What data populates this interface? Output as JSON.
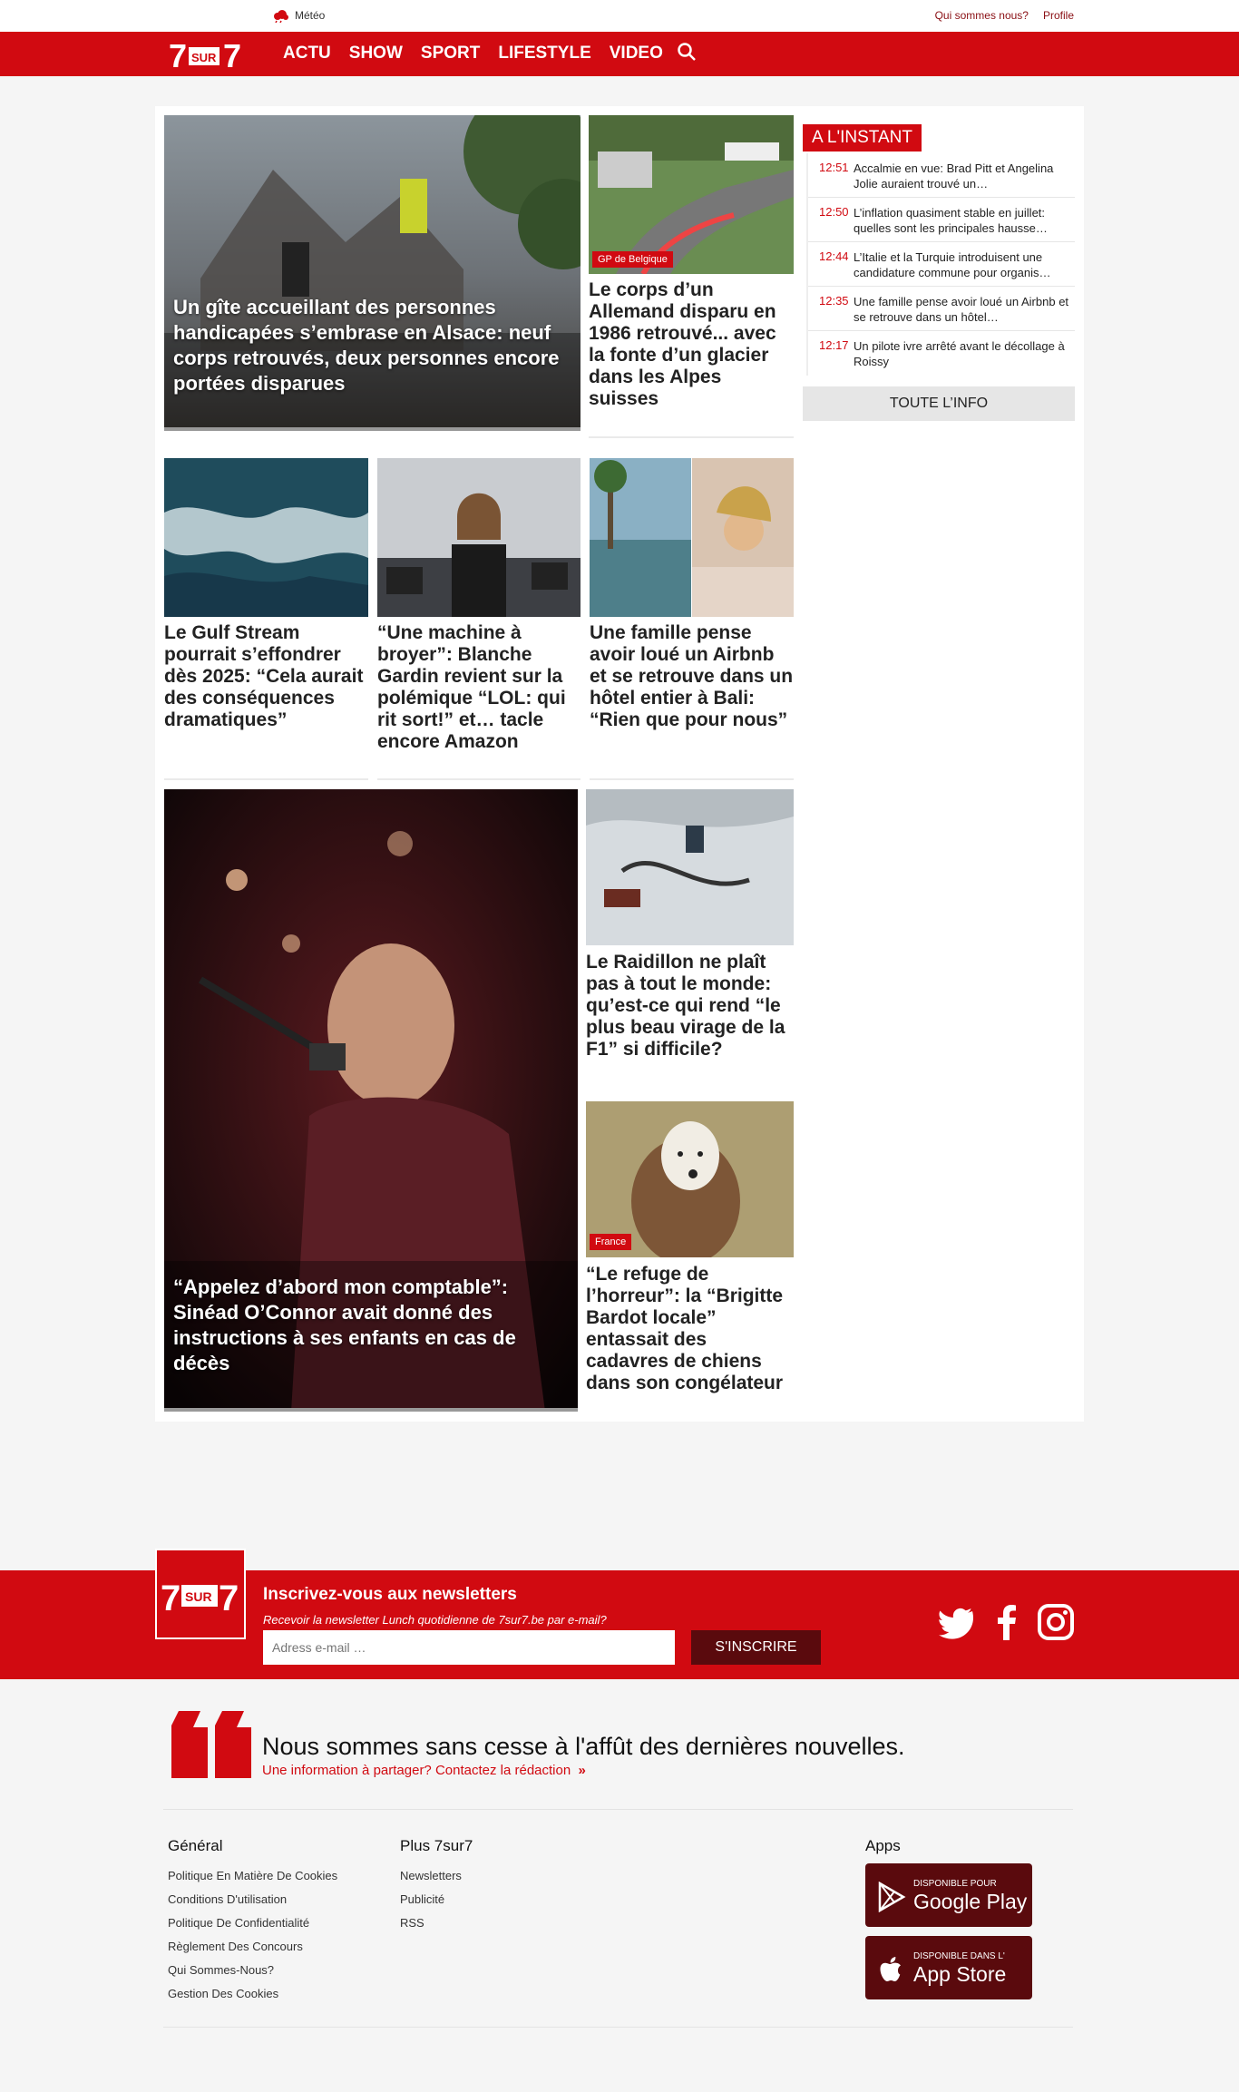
{
  "topbar": {
    "meteo": "Météo",
    "links": [
      "Qui sommes nous?",
      "Profile"
    ]
  },
  "nav": {
    "logo": "7SUR7",
    "items": [
      "ACTU",
      "SHOW",
      "SPORT",
      "LIFESTYLE",
      "VIDEO"
    ]
  },
  "articles": [
    {
      "title": "Un gîte accueillant des personnes handicapées s’embrase en Alsace: neuf corps retrouvés, deux personnes encore portées disparues"
    },
    {
      "tag": "GP de Belgique",
      "title": "Le corps d’un Allemand disparu en 1986 retrouvé... avec la fonte d’un glacier dans les Alpes suisses"
    },
    {
      "title": "Le Gulf Stream pourrait s’effondrer dès 2025: “Cela aurait des conséquences dramatiques”"
    },
    {
      "title": "“Une machine à broyer”: Blanche Gardin revient sur la polémique “LOL: qui rit sort!” et… tacle encore Amazon"
    },
    {
      "title": "Une famille pense avoir loué un Airbnb et se retrouve dans un hôtel entier à Bali: “Rien que pour nous”"
    },
    {
      "title": "“Appelez d’abord mon comptable”: Sinéad O’Connor avait donné des instructions à ses enfants en cas de décès"
    },
    {
      "title": "Le Raidillon ne plaît pas à tout le monde: qu’est-ce qui rend “le plus beau virage de la F1” si difficile?"
    },
    {
      "tag": "France",
      "title": "“Le refuge de l’horreur”: la “Brigitte Bardot locale” entassait des cadavres de chiens dans son congélateur"
    }
  ],
  "instant": {
    "heading": "A L'INSTANT",
    "items": [
      {
        "time": "12:51",
        "text": "Accalmie en vue: Brad Pitt et Angelina Jolie auraient trouvé un…"
      },
      {
        "time": "12:50",
        "text": "L’inflation quasiment stable en juillet: quelles sont les principales hausse…"
      },
      {
        "time": "12:44",
        "text": "L’Italie et la Turquie introduisent une candidature commune pour organis…"
      },
      {
        "time": "12:35",
        "text": "Une famille pense avoir loué un Airbnb et se retrouve dans un hôtel…"
      },
      {
        "time": "12:17",
        "text": "Un pilote ivre arrêté avant le décollage à Roissy"
      }
    ],
    "button": "TOUTE L’INFO"
  },
  "newsletter": {
    "title": "Inscrivez-vous aux newsletters",
    "subtitle": "Recevoir la newsletter Lunch quotidienne de 7sur7.be par e-mail?",
    "placeholder": "Adress e-mail …",
    "button": "S'INSCRIRE",
    "social": [
      "twitter-icon",
      "facebook-icon",
      "instagram-icon"
    ]
  },
  "footer": {
    "quote": "Nous sommes sans cesse à l'affût des dernières nouvelles.",
    "quote_link": "Une information à partager? Contactez la rédaction",
    "col1": {
      "head": "Général",
      "items": [
        "Politique En Matière De Cookies",
        "Conditions D'utilisation",
        "Politique De Confidentialité",
        "Règlement Des Concours",
        "Qui Sommes-Nous?",
        "Gestion Des Cookies"
      ]
    },
    "col2": {
      "head": "Plus 7sur7",
      "items": [
        "Newsletters",
        "Publicité",
        "RSS"
      ]
    },
    "apps": {
      "head": "Apps",
      "google_small": "DISPONIBLE POUR",
      "google_big": "Google Play",
      "apple_small": "DISPONIBLE DANS L'",
      "apple_big": "App Store"
    }
  },
  "colors": {
    "brand": "#d10a11",
    "dark": "#5a0a0d"
  }
}
